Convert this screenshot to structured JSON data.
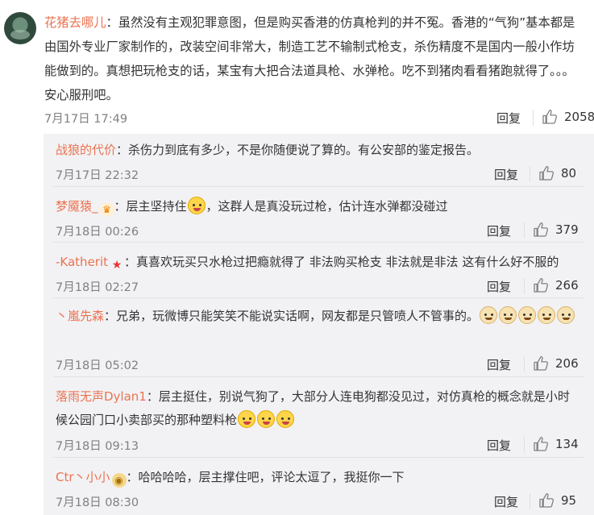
{
  "main": {
    "username": "花猪去哪儿",
    "content": "：虽然没有主观犯罪意图，但是购买香港的仿真枪判的并不冤。香港的“气狗”基本都是由国外专业厂家制作的，改装空间非常大，制造工艺不输制式枪支，杀伤精度不是国内一般小作坊能做到的。真想把玩枪支的话，某宝有大把合法道具枪、水弹枪。吃不到猪肉看看猪跑就得了。。。安心服刑吧。",
    "time": "7月17日 17:49",
    "reply_label": "回复",
    "likes": "2058"
  },
  "subs": [
    {
      "username": "战狼的代价",
      "content": "：杀伤力到底有多少，不是你随便说了算的。有公安部的鉴定报告。",
      "time": "7月17日 22:32",
      "reply_label": "回复",
      "likes": "80"
    },
    {
      "username": "梦魇猿_",
      "content": "：层主坚持住",
      "content_tail": "，这群人是真没玩过枪，估计连水弹都没碰过",
      "time": "7月18日 00:26",
      "reply_label": "回复",
      "likes": "379"
    },
    {
      "username": "-Katherit",
      "content": "：真喜欢玩买只水枪过把瘾就得了 非法购买枪支 非法就是非法 这有什么好不服的",
      "time": "7月18日 02:27",
      "reply_label": "回复",
      "likes": "266"
    },
    {
      "username": "丶嵐先森",
      "content": "：兄弟，玩微博只能笑笑不能说实话啊，网友都是只管喷人不管事的。",
      "time": "7月18日 05:02",
      "reply_label": "回复",
      "likes": "206"
    },
    {
      "username": "落雨无声Dylan1",
      "content": "：层主挺住，别说气狗了，大部分人连电狗都没见过，对仿真枪的概念就是小时候公园门口小卖部买的那种塑料枪",
      "time": "7月18日 09:13",
      "reply_label": "回复",
      "likes": "134"
    },
    {
      "username": "Ctr丶小小",
      "content": "：哈哈哈哈，层主撑住吧，评论太逗了，我挺你一下",
      "time": "7月18日 08:30",
      "reply_label": "回复",
      "likes": "95"
    }
  ],
  "colors": {
    "username": "#eb7350",
    "subs_bg": "#f2f2f5",
    "time": "#808080"
  },
  "icons": {
    "like": "thumbs-up-icon",
    "avatar": "avatar",
    "badge_1": "vip-badge-icon",
    "badge_2": "star-badge-icon",
    "badge_3": "gold-badge-icon"
  }
}
